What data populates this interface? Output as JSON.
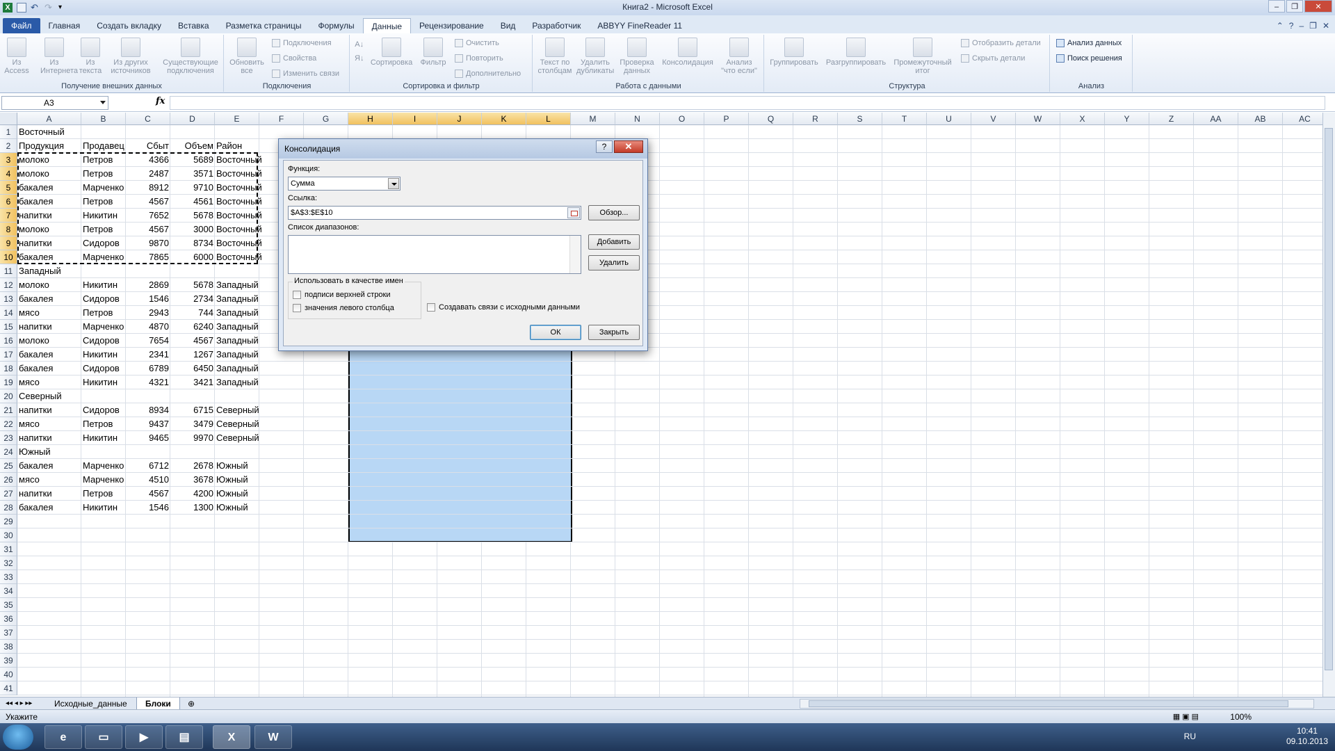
{
  "window": {
    "title": "Книга2 - Microsoft Excel"
  },
  "ribbon_tabs": [
    "Файл",
    "Главная",
    "Создать вкладку",
    "Вставка",
    "Разметка страницы",
    "Формулы",
    "Данные",
    "Рецензирование",
    "Вид",
    "Разработчик",
    "ABBYY FineReader 11"
  ],
  "active_tab": "Данные",
  "ribbon": {
    "ext_data": {
      "label": "Получение внешних данных",
      "buttons": [
        "Из Access",
        "Из Интернета",
        "Из текста",
        "Из других источников",
        "Существующие подключения"
      ]
    },
    "connections": {
      "label": "Подключения",
      "refresh": "Обновить все",
      "items": [
        "Подключения",
        "Свойства",
        "Изменить связи"
      ]
    },
    "sort_filter": {
      "label": "Сортировка и фильтр",
      "sort": "Сортировка",
      "filter": "Фильтр",
      "items": [
        "Очистить",
        "Повторить",
        "Дополнительно"
      ]
    },
    "data_tools": {
      "label": "Работа с данными",
      "buttons": [
        "Текст по столбцам",
        "Удалить дубликаты",
        "Проверка данных",
        "Консолидация",
        "Анализ \"что если\""
      ]
    },
    "outline": {
      "label": "Структура",
      "buttons": [
        "Группировать",
        "Разгруппировать",
        "Промежуточный итог"
      ],
      "items": [
        "Отобразить детали",
        "Скрыть детали"
      ]
    },
    "analysis": {
      "label": "Анализ",
      "items": [
        "Анализ данных",
        "Поиск решения"
      ]
    }
  },
  "formula_bar": {
    "name_box": "A3",
    "fx": "fx",
    "formula": ""
  },
  "columns": [
    "A",
    "B",
    "C",
    "D",
    "E",
    "F",
    "G",
    "H",
    "I",
    "J",
    "K",
    "L",
    "M",
    "N",
    "O",
    "P",
    "Q",
    "R",
    "S",
    "T",
    "U",
    "V",
    "W",
    "X",
    "Y",
    "Z",
    "AA",
    "AB",
    "AC"
  ],
  "rows": [
    [
      "Восточный",
      "",
      "",
      "",
      ""
    ],
    [
      "Продукция",
      "Продавец",
      "Сбыт",
      "Объем",
      "Район"
    ],
    [
      "молоко",
      "Петров",
      "4366",
      "5689",
      "Восточный"
    ],
    [
      "молоко",
      "Петров",
      "2487",
      "3571",
      "Восточный"
    ],
    [
      "бакалея",
      "Марченко",
      "8912",
      "9710",
      "Восточный"
    ],
    [
      "бакалея",
      "Петров",
      "4567",
      "4561",
      "Восточный"
    ],
    [
      "напитки",
      "Никитин",
      "7652",
      "5678",
      "Восточный"
    ],
    [
      "молоко",
      "Петров",
      "4567",
      "3000",
      "Восточный"
    ],
    [
      "напитки",
      "Сидоров",
      "9870",
      "8734",
      "Восточный"
    ],
    [
      "бакалея",
      "Марченко",
      "7865",
      "6000",
      "Восточный"
    ],
    [
      "Западный",
      "",
      "",
      "",
      ""
    ],
    [
      "молоко",
      "Никитин",
      "2869",
      "5678",
      "Западный"
    ],
    [
      "бакалея",
      "Сидоров",
      "1546",
      "2734",
      "Западный"
    ],
    [
      "мясо",
      "Петров",
      "2943",
      "744",
      "Западный"
    ],
    [
      "напитки",
      "Марченко",
      "4870",
      "6240",
      "Западный"
    ],
    [
      "молоко",
      "Сидоров",
      "7654",
      "4567",
      "Западный"
    ],
    [
      "бакалея",
      "Никитин",
      "2341",
      "1267",
      "Западный"
    ],
    [
      "бакалея",
      "Сидоров",
      "6789",
      "6450",
      "Западный"
    ],
    [
      "мясо",
      "Никитин",
      "4321",
      "3421",
      "Западный"
    ],
    [
      "Северный",
      "",
      "",
      "",
      ""
    ],
    [
      "напитки",
      "Сидоров",
      "8934",
      "6715",
      "Северный"
    ],
    [
      "мясо",
      "Петров",
      "9437",
      "3479",
      "Северный"
    ],
    [
      "напитки",
      "Никитин",
      "9465",
      "9970",
      "Северный"
    ],
    [
      "Южный",
      "",
      "",
      "",
      ""
    ],
    [
      "бакалея",
      "Марченко",
      "6712",
      "2678",
      "Южный"
    ],
    [
      "мясо",
      "Марченко",
      "4510",
      "3678",
      "Южный"
    ],
    [
      "напитки",
      "Петров",
      "4567",
      "4200",
      "Южный"
    ],
    [
      "бакалея",
      "Никитин",
      "1546",
      "1300",
      "Южный"
    ]
  ],
  "row_count": 41,
  "sheet_tabs": [
    "Исходные_данные",
    "Блоки"
  ],
  "active_sheet": "Блоки",
  "status": {
    "mode": "Укажите",
    "zoom": "100%"
  },
  "taskbar": {
    "lang": "RU",
    "time": "10:41",
    "date": "09.10.2013"
  },
  "dialog": {
    "title": "Консолидация",
    "help": "?",
    "close": "✕",
    "function_label": "Функция:",
    "function_value": "Сумма",
    "reference_label": "Ссылка:",
    "reference_value": "$A$3:$E$10",
    "browse": "Обзор...",
    "ranges_label": "Список диапазонов:",
    "add": "Добавить",
    "delete": "Удалить",
    "use_labels_legend": "Использовать в качестве имен",
    "top_row": "подписи верхней строки",
    "left_column": "значения левого столбца",
    "create_links": "Создавать связи с исходными данными",
    "ok": "ОК",
    "close_button": "Закрыть"
  }
}
